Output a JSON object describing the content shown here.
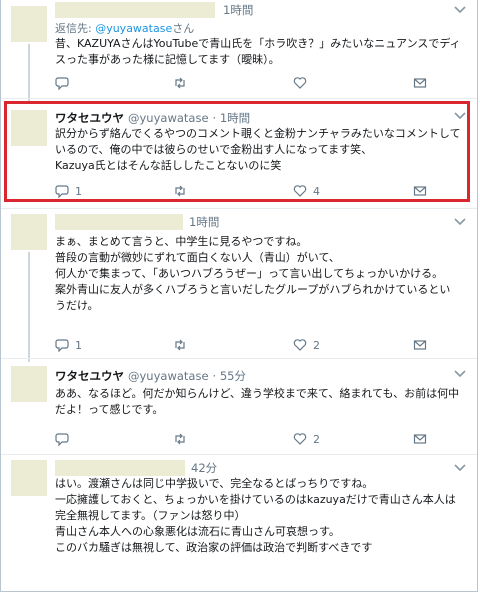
{
  "tweets": [
    {
      "time": "1時間",
      "reply_prefix": "返信先: ",
      "reply_handle": "@yuyawatase",
      "reply_suffix": "さん",
      "text": "昔、KAZUYAさんはYouTubeで青山氏を「ホラ吹き？」みたいなニュアンスでディスった事があった様に記憶してます（曖昧）。",
      "counts": {
        "reply": "",
        "retweet": "",
        "like": ""
      }
    },
    {
      "name": "ワタセユウヤ",
      "handle": "@yuyawatase",
      "time": "1時間",
      "text": "訳分からず絡んでくるやつのコメント覗くと金粉ナンチャラみたいなコメントしているので、俺の中では彼らのせいで金粉出す人になってます笑、\nKazuya氏とはそんな話ししたことないのに笑",
      "counts": {
        "reply": "1",
        "retweet": "",
        "like": "4"
      }
    },
    {
      "time": "1時間",
      "text": "まぁ、まとめて言うと、中学生に見るやつですね。\n普段の言動が微妙にずれて面白くない人（青山）がいて、\n何人かで集まって、「あいつハブろうぜー」って言い出してちょっかいかける。\n案外青山に友人が多くハブろうと言いだしたグループがハブられかけているというだけ。",
      "counts": {
        "reply": "1",
        "retweet": "",
        "like": "2"
      }
    },
    {
      "name": "ワタセユウヤ",
      "handle": "@yuyawatase",
      "time": "55分",
      "text": "ああ、なるほど。何だか知らんけど、違う学校まで来て、絡まれても、お前は何中だよ！って感じです。",
      "counts": {
        "reply": "",
        "retweet": "",
        "like": "2"
      }
    },
    {
      "time": "42分",
      "text": "はい。渡瀬さんは同じ中学扱いで、完全なるとばっちりですね。\n一応擁護しておくと、ちょっかいを掛けているのはkazuyaだけで青山さん本人は完全無視してます。（ファンは怒り中）\n青山さん本人への心象悪化は流石に青山さん可哀想っす。\nこのバカ騒ぎは無視して、政治家の評価は政治で判断すべきです"
    }
  ],
  "colors": {
    "accent": "#1b95e0",
    "highlight": "#d9262f",
    "muted": "#657786"
  }
}
